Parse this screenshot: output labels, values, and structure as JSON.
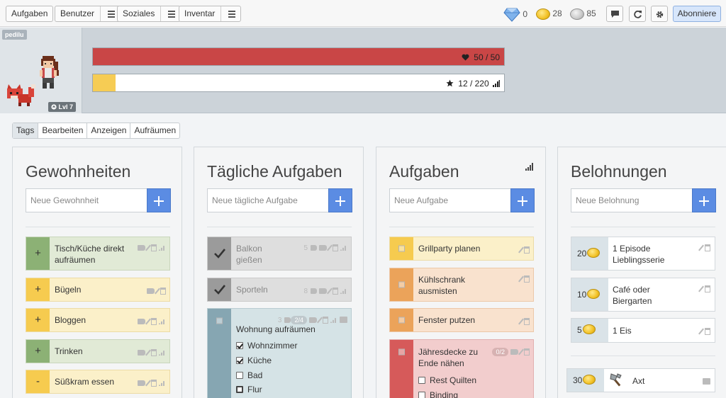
{
  "nav": {
    "tasks": "Aufgaben",
    "user": "Benutzer",
    "social": "Soziales",
    "inventory": "Inventar",
    "gems": "0",
    "gold": "28",
    "silver": "85",
    "subscribe": "Abonniere"
  },
  "header": {
    "username": "pedilu",
    "level": "Lvl 7",
    "health_text": "50 / 50",
    "health_fraction": 1.0,
    "xp_text": "12 / 220",
    "xp_fraction": 0.0545,
    "health_color": "#c94646",
    "xp_color": "#f6cc54"
  },
  "tagbar": [
    "Tags",
    "Bearbeiten",
    "Anzeigen",
    "Aufräumen"
  ],
  "habits": {
    "title": "Gewohnheiten",
    "placeholder": "Neue Gewohnheit",
    "items": [
      {
        "title": "Tisch/Küche direkt aufräumen",
        "sign": "+",
        "color": "green"
      },
      {
        "title": "Bügeln",
        "sign": "+",
        "color": "yellow"
      },
      {
        "title": "Bloggen",
        "sign": "+",
        "color": "yellow"
      },
      {
        "title": "Trinken",
        "sign": "+",
        "color": "green"
      },
      {
        "title": "Süßkram essen",
        "sign": "-",
        "color": "yellow"
      }
    ]
  },
  "dailies": {
    "title": "Tägliche Aufgaben",
    "placeholder": "Neue tägliche Aufgabe",
    "items": [
      {
        "title": "Balkon gießen",
        "streak": "5",
        "done": true
      },
      {
        "title": "Sporteln",
        "streak": "8",
        "done": true
      },
      {
        "title": "Wohnung aufräumen",
        "streak": "3",
        "progress": "2/4",
        "done": false,
        "checklist": [
          {
            "label": "Wohnzimmer",
            "checked": true
          },
          {
            "label": "Küche",
            "checked": true
          },
          {
            "label": "Bad",
            "checked": false
          },
          {
            "label": "Flur",
            "checked": false
          }
        ]
      }
    ]
  },
  "todos": {
    "title": "Aufgaben",
    "placeholder": "Neue Aufgabe",
    "items": [
      {
        "title": "Grillparty planen",
        "color": "yellow"
      },
      {
        "title": "Kühlschrank ausmisten",
        "color": "orange"
      },
      {
        "title": "Fenster putzen",
        "color": "orange"
      },
      {
        "title": "Jähresdecke zu Ende nähen",
        "color": "red",
        "progress": "0/2",
        "checklist": [
          {
            "label": "Rest Quilten",
            "checked": false
          },
          {
            "label": "Binding",
            "checked": false
          }
        ]
      }
    ]
  },
  "rewards": {
    "title": "Belohnungen",
    "placeholder": "Neue Belohnung",
    "items": [
      {
        "title": "1 Episode Lieblingsserie",
        "cost": "20"
      },
      {
        "title": "Café oder Biergarten",
        "cost": "10"
      },
      {
        "title": "1 Eis",
        "cost": "5"
      }
    ],
    "shop": [
      {
        "title": "Axt",
        "cost": "30"
      }
    ]
  }
}
